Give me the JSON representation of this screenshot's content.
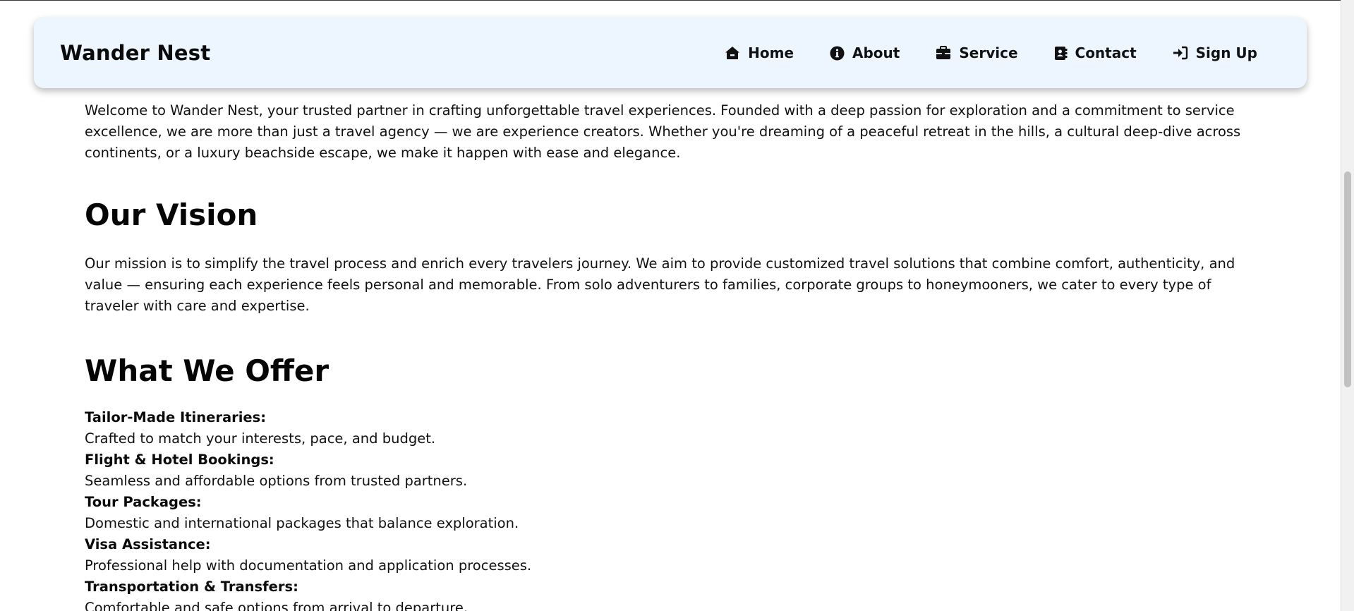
{
  "navbar": {
    "brand": "Wander Nest",
    "links": [
      {
        "label": "Home",
        "icon": "home-icon"
      },
      {
        "label": "About",
        "icon": "info-icon"
      },
      {
        "label": "Service",
        "icon": "briefcase-icon"
      },
      {
        "label": "Contact",
        "icon": "address-book-icon"
      },
      {
        "label": "Sign Up",
        "icon": "sign-in-icon"
      }
    ]
  },
  "intro": "Welcome to Wander Nest, your trusted partner in crafting unforgettable travel experiences. Founded with a deep passion for exploration and a commitment to service excellence, we are more than just a travel agency — we are experience creators. Whether you're dreaming of a peaceful retreat in the hills, a cultural deep-dive across continents, or a luxury beachside escape, we make it happen with ease and elegance.",
  "vision": {
    "title": "Our Vision",
    "text": "Our mission is to simplify the travel process and enrich every travelers journey. We aim to provide customized travel solutions that combine comfort, authenticity, and value — ensuring each experience feels personal and memorable. From solo adventurers to families, corporate groups to honeymooners, we cater to every type of traveler with care and expertise."
  },
  "offer": {
    "title": "What We Offer",
    "items": [
      {
        "name": "Tailor-Made Itineraries:",
        "desc": "Crafted to match your interests, pace, and budget."
      },
      {
        "name": "Flight & Hotel Bookings:",
        "desc": "Seamless and affordable options from trusted partners."
      },
      {
        "name": "Tour Packages:",
        "desc": "Domestic and international packages that balance exploration."
      },
      {
        "name": "Visa Assistance:",
        "desc": "Professional help with documentation and application processes."
      },
      {
        "name": "Transportation & Transfers:",
        "desc": "Comfortable and safe options from arrival to departure."
      }
    ]
  },
  "colors": {
    "navbar_bg": "#edf6ff",
    "text": "#111111"
  }
}
